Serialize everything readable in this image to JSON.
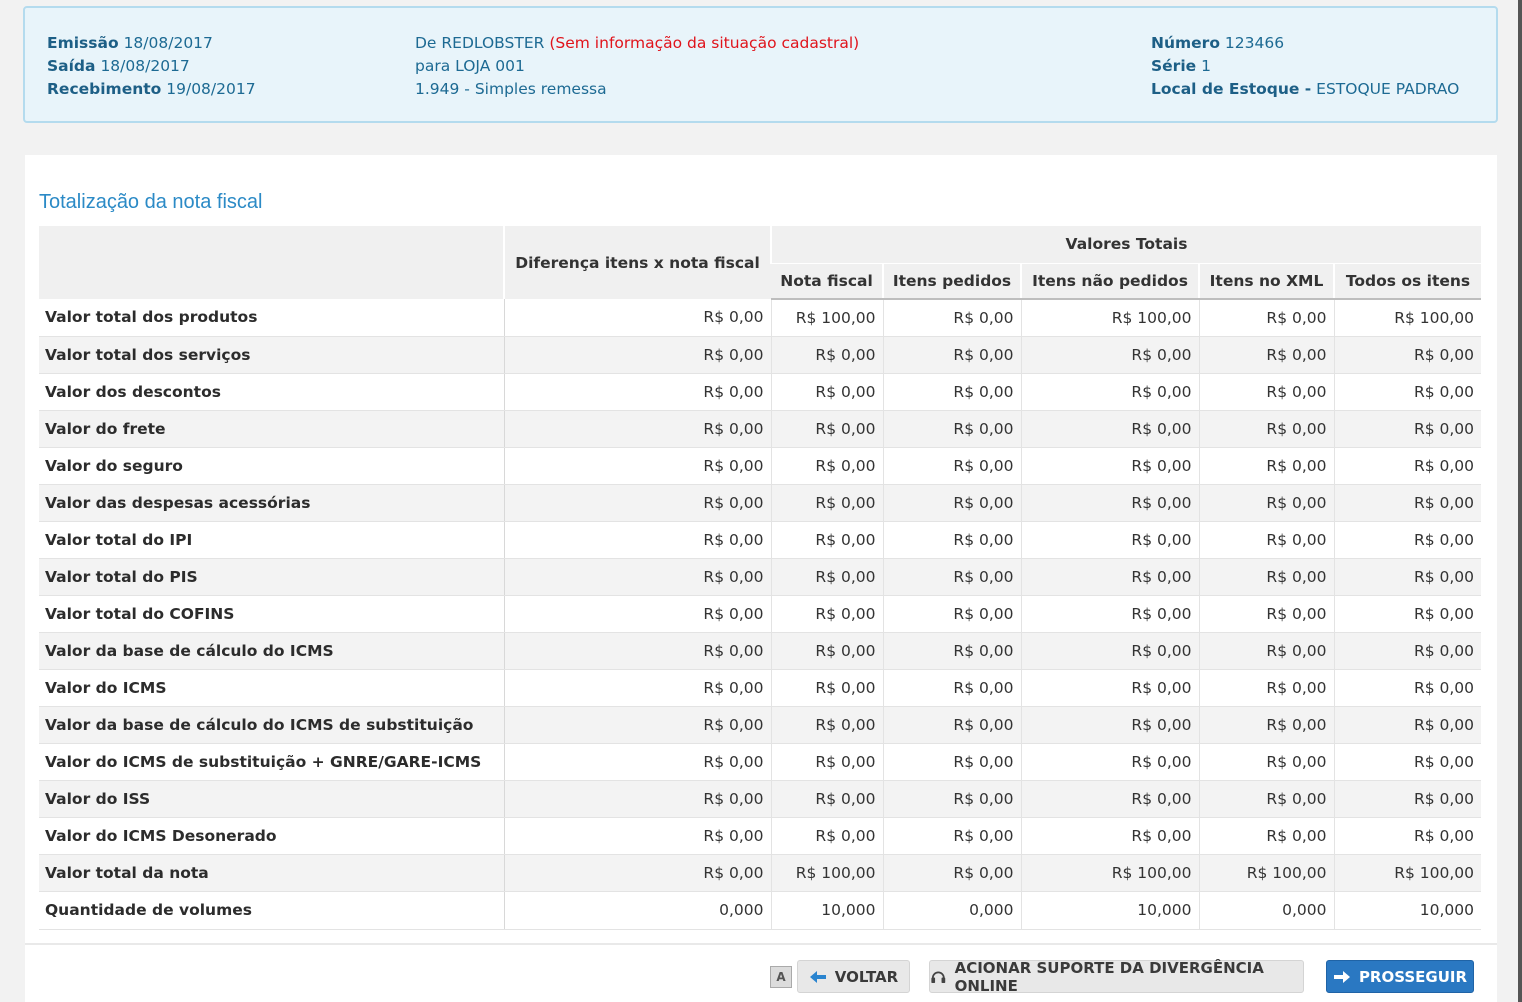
{
  "header": {
    "emissao_label": "Emissão",
    "emissao_value": "18/08/2017",
    "saida_label": "Saída",
    "saida_value": "18/08/2017",
    "recebimento_label": "Recebimento",
    "recebimento_value": "19/08/2017",
    "de_text": "De REDLOBSTER",
    "situacao_text": "(Sem informação da situação cadastral)",
    "para_text": "para LOJA 001",
    "cfop_text": "1.949 - Simples remessa",
    "numero_label": "Número",
    "numero_value": "123466",
    "serie_label": "Série",
    "serie_value": "1",
    "estoque_label": "Local de Estoque -",
    "estoque_value": "ESTOQUE PADRAO"
  },
  "section_title": "Totalização da nota fiscal",
  "table": {
    "header_diff": "Diferença itens x nota fiscal",
    "header_group": "Valores Totais",
    "columns": [
      "Nota fiscal",
      "Itens pedidos",
      "Itens não pedidos",
      "Itens no XML",
      "Todos os itens"
    ],
    "rows": [
      {
        "label": "Valor total dos produtos",
        "values": [
          "R$ 0,00",
          "R$ 100,00",
          "R$ 0,00",
          "R$ 100,00",
          "R$ 0,00",
          "R$ 100,00"
        ]
      },
      {
        "label": "Valor total dos serviços",
        "values": [
          "R$ 0,00",
          "R$ 0,00",
          "R$ 0,00",
          "R$ 0,00",
          "R$ 0,00",
          "R$ 0,00"
        ]
      },
      {
        "label": "Valor dos descontos",
        "values": [
          "R$ 0,00",
          "R$ 0,00",
          "R$ 0,00",
          "R$ 0,00",
          "R$ 0,00",
          "R$ 0,00"
        ]
      },
      {
        "label": "Valor do frete",
        "values": [
          "R$ 0,00",
          "R$ 0,00",
          "R$ 0,00",
          "R$ 0,00",
          "R$ 0,00",
          "R$ 0,00"
        ]
      },
      {
        "label": "Valor do seguro",
        "values": [
          "R$ 0,00",
          "R$ 0,00",
          "R$ 0,00",
          "R$ 0,00",
          "R$ 0,00",
          "R$ 0,00"
        ]
      },
      {
        "label": "Valor das despesas acessórias",
        "values": [
          "R$ 0,00",
          "R$ 0,00",
          "R$ 0,00",
          "R$ 0,00",
          "R$ 0,00",
          "R$ 0,00"
        ]
      },
      {
        "label": "Valor total do IPI",
        "values": [
          "R$ 0,00",
          "R$ 0,00",
          "R$ 0,00",
          "R$ 0,00",
          "R$ 0,00",
          "R$ 0,00"
        ]
      },
      {
        "label": "Valor total do PIS",
        "values": [
          "R$ 0,00",
          "R$ 0,00",
          "R$ 0,00",
          "R$ 0,00",
          "R$ 0,00",
          "R$ 0,00"
        ]
      },
      {
        "label": "Valor total do COFINS",
        "values": [
          "R$ 0,00",
          "R$ 0,00",
          "R$ 0,00",
          "R$ 0,00",
          "R$ 0,00",
          "R$ 0,00"
        ]
      },
      {
        "label": "Valor da base de cálculo do ICMS",
        "values": [
          "R$ 0,00",
          "R$ 0,00",
          "R$ 0,00",
          "R$ 0,00",
          "R$ 0,00",
          "R$ 0,00"
        ]
      },
      {
        "label": "Valor do ICMS",
        "values": [
          "R$ 0,00",
          "R$ 0,00",
          "R$ 0,00",
          "R$ 0,00",
          "R$ 0,00",
          "R$ 0,00"
        ]
      },
      {
        "label": "Valor da base de cálculo do ICMS de substituição",
        "values": [
          "R$ 0,00",
          "R$ 0,00",
          "R$ 0,00",
          "R$ 0,00",
          "R$ 0,00",
          "R$ 0,00"
        ]
      },
      {
        "label": "Valor do ICMS de substituição + GNRE/GARE-ICMS",
        "values": [
          "R$ 0,00",
          "R$ 0,00",
          "R$ 0,00",
          "R$ 0,00",
          "R$ 0,00",
          "R$ 0,00"
        ]
      },
      {
        "label": "Valor do ISS",
        "values": [
          "R$ 0,00",
          "R$ 0,00",
          "R$ 0,00",
          "R$ 0,00",
          "R$ 0,00",
          "R$ 0,00"
        ]
      },
      {
        "label": "Valor do ICMS Desonerado",
        "values": [
          "R$ 0,00",
          "R$ 0,00",
          "R$ 0,00",
          "R$ 0,00",
          "R$ 0,00",
          "R$ 0,00"
        ]
      },
      {
        "label": "Valor total da nota",
        "values": [
          "R$ 0,00",
          "R$ 100,00",
          "R$ 0,00",
          "R$ 100,00",
          "R$ 100,00",
          "R$ 100,00"
        ]
      },
      {
        "label": "Quantidade de volumes",
        "values": [
          "0,000",
          "10,000",
          "0,000",
          "10,000",
          "0,000",
          "10,000"
        ]
      }
    ]
  },
  "buttons": {
    "font_size_label": "A",
    "voltar": "VOLTAR",
    "suporte": "ACIONAR SUPORTE DA DIVERGÊNCIA ONLINE",
    "prosseguir": "PROSSEGUIR"
  },
  "icons": {
    "voltar": "arrow-left-icon",
    "suporte": "headset-icon",
    "prosseguir": "arrow-right-icon"
  },
  "colors": {
    "accent": "#2b8ac6",
    "warning": "#e0141c",
    "primary_button": "#2a78c2"
  }
}
